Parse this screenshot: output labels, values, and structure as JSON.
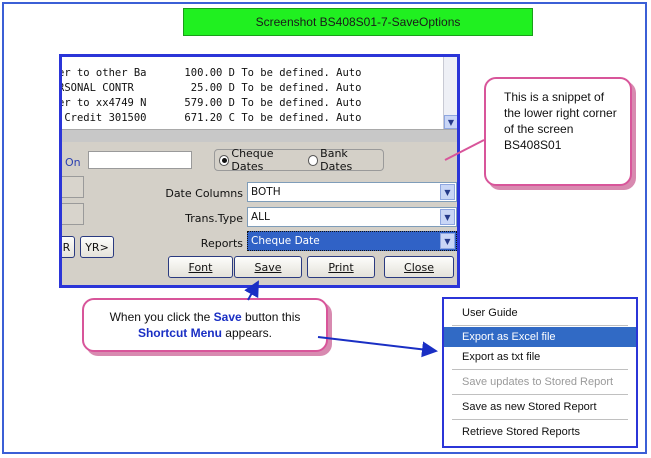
{
  "banner": {
    "title": "Screenshot BS408S01-7-SaveOptions"
  },
  "listing": {
    "lines": [
      "er to other Ba      100.00 D To be defined. Auto",
      "RSONAL CONTR         25.00 D To be defined. Auto",
      "er to xx4749 N      579.00 D To be defined. Auto",
      " Credit 301500      671.20 C To be defined. Auto"
    ]
  },
  "form": {
    "on_label": "On",
    "on_value": "",
    "radio_cheque": "Cheque Dates",
    "radio_bank": "Bank Dates",
    "date_columns_label": "Date Columns",
    "date_columns_value": "BOTH",
    "trans_type_label": "Trans.Type",
    "trans_type_value": "ALL",
    "reports_label": "Reports",
    "reports_value": "Cheque Date",
    "yr_back_label": "R",
    "yr_fwd_label": "YR>",
    "font_btn": "Font",
    "save_btn": "Save",
    "print_btn": "Print",
    "close_btn": "Close"
  },
  "callouts": {
    "right_text": "This is a snippet of the lower right corner of the screen BS408S01",
    "bottom_pre": "When you click the ",
    "bottom_save": "Save",
    "bottom_mid": " button this ",
    "bottom_menu": "Shortcut Menu",
    "bottom_post": " appears."
  },
  "menu": {
    "items": [
      {
        "label": "User Guide",
        "state": "normal"
      },
      {
        "label": "Export as Excel file",
        "state": "highlighted"
      },
      {
        "label": "Export as txt file",
        "state": "normal"
      },
      {
        "label": "Save updates to Stored Report",
        "state": "disabled"
      },
      {
        "label": "Save as new Stored Report",
        "state": "normal"
      },
      {
        "label": "Retrieve Stored Reports",
        "state": "normal"
      }
    ]
  },
  "colors": {
    "banner": "#20f020",
    "frame": "#2b35d8",
    "callout_border": "#d8559a",
    "menu_highlight": "#316ac5"
  }
}
